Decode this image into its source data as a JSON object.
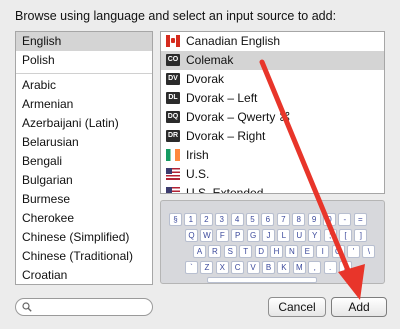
{
  "instruction": "Browse using language and select an input source to add:",
  "languages": {
    "pinned": [
      "English",
      "Polish"
    ],
    "selected_index": 0,
    "others": [
      "Arabic",
      "Armenian",
      "Azerbaijani (Latin)",
      "Belarusian",
      "Bengali",
      "Bulgarian",
      "Burmese",
      "Cherokee",
      "Chinese (Simplified)",
      "Chinese (Traditional)",
      "Croatian"
    ]
  },
  "sources": {
    "selected_index": 1,
    "items": [
      {
        "label": "Canadian English",
        "icon": "canada-flag-icon",
        "badge": ""
      },
      {
        "label": "Colemak",
        "icon": "colemak-icon",
        "badge": "CO"
      },
      {
        "label": "Dvorak",
        "icon": "dvorak-icon",
        "badge": "DV"
      },
      {
        "label": "Dvorak – Left",
        "icon": "dvorak-left-icon",
        "badge": "DL"
      },
      {
        "label": "Dvorak – Qwerty ⌘",
        "icon": "dvorak-qwerty-icon",
        "badge": "DQ"
      },
      {
        "label": "Dvorak – Right",
        "icon": "dvorak-right-icon",
        "badge": "DR"
      },
      {
        "label": "Irish",
        "icon": "ireland-flag-icon",
        "badge": ""
      },
      {
        "label": "U.S.",
        "icon": "us-flag-icon",
        "badge": ""
      },
      {
        "label": "U.S. Extended",
        "icon": "us-flag-icon",
        "badge": ""
      }
    ]
  },
  "keyboard": {
    "rows": [
      [
        "§",
        "1",
        "2",
        "3",
        "4",
        "5",
        "6",
        "7",
        "8",
        "9",
        "0",
        "-",
        "="
      ],
      [
        "Q",
        "W",
        "F",
        "P",
        "G",
        "J",
        "L",
        "U",
        "Y",
        ";",
        "[",
        "]"
      ],
      [
        "A",
        "R",
        "S",
        "T",
        "D",
        "H",
        "N",
        "E",
        "I",
        "O",
        "'",
        "\\"
      ],
      [
        "`",
        "Z",
        "X",
        "C",
        "V",
        "B",
        "K",
        "M",
        ",",
        ".",
        "/"
      ],
      [
        ""
      ]
    ]
  },
  "search": {
    "placeholder": ""
  },
  "buttons": {
    "cancel": "Cancel",
    "add": "Add"
  },
  "colors": {
    "selection": "#d4d4d4",
    "annotation_arrow": "#e8352a",
    "key_text": "#3c4a9c"
  }
}
